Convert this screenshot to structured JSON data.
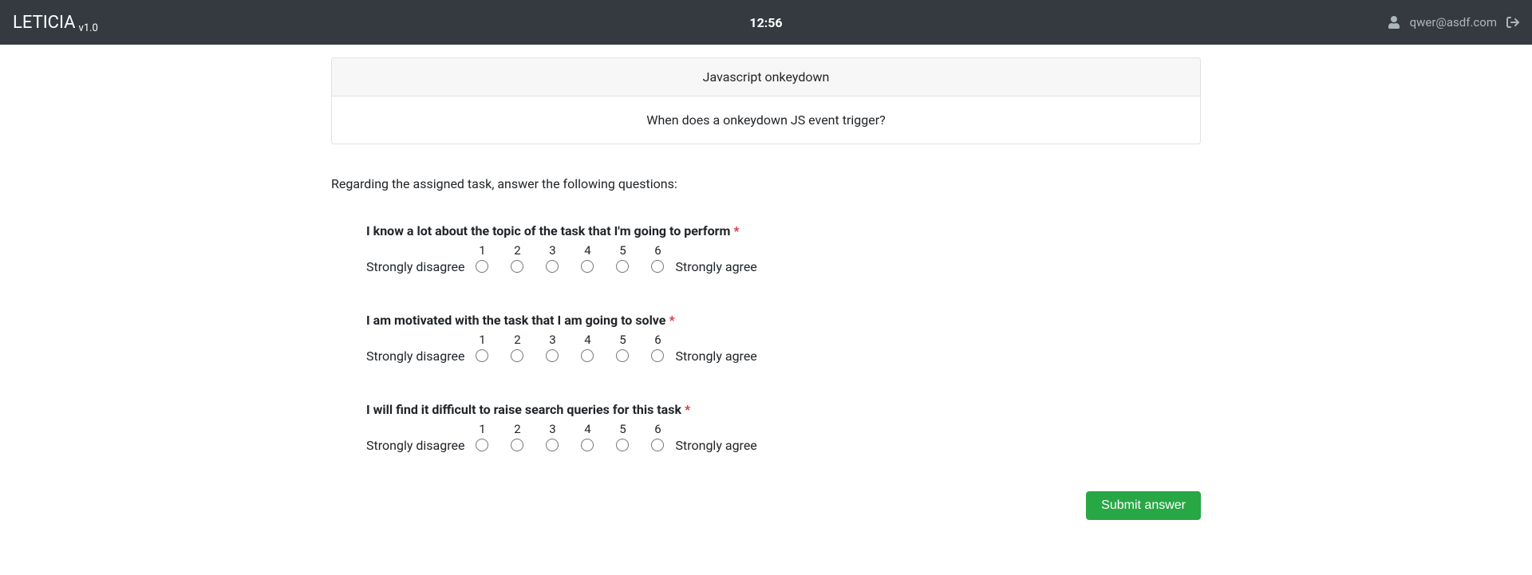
{
  "navbar": {
    "brand": "LETICIA",
    "version": "v1.0",
    "time": "12:56",
    "user": "qwer@asdf.com"
  },
  "task": {
    "title": "Javascript onkeydown",
    "description": "When does a onkeydown JS event trigger?"
  },
  "instructions": "Regarding the assigned task, answer the following questions:",
  "scale": {
    "left": "Strongly disagree",
    "right": "Strongly agree",
    "points": [
      "1",
      "2",
      "3",
      "4",
      "5",
      "6"
    ]
  },
  "questions": [
    {
      "text": "I know a lot about the topic of the task that I'm going to perform",
      "required": "*"
    },
    {
      "text": "I am motivated with the task that I am going to solve",
      "required": "*"
    },
    {
      "text": "I will find it difficult to raise search queries for this task",
      "required": "*"
    }
  ],
  "submit_label": "Submit answer"
}
